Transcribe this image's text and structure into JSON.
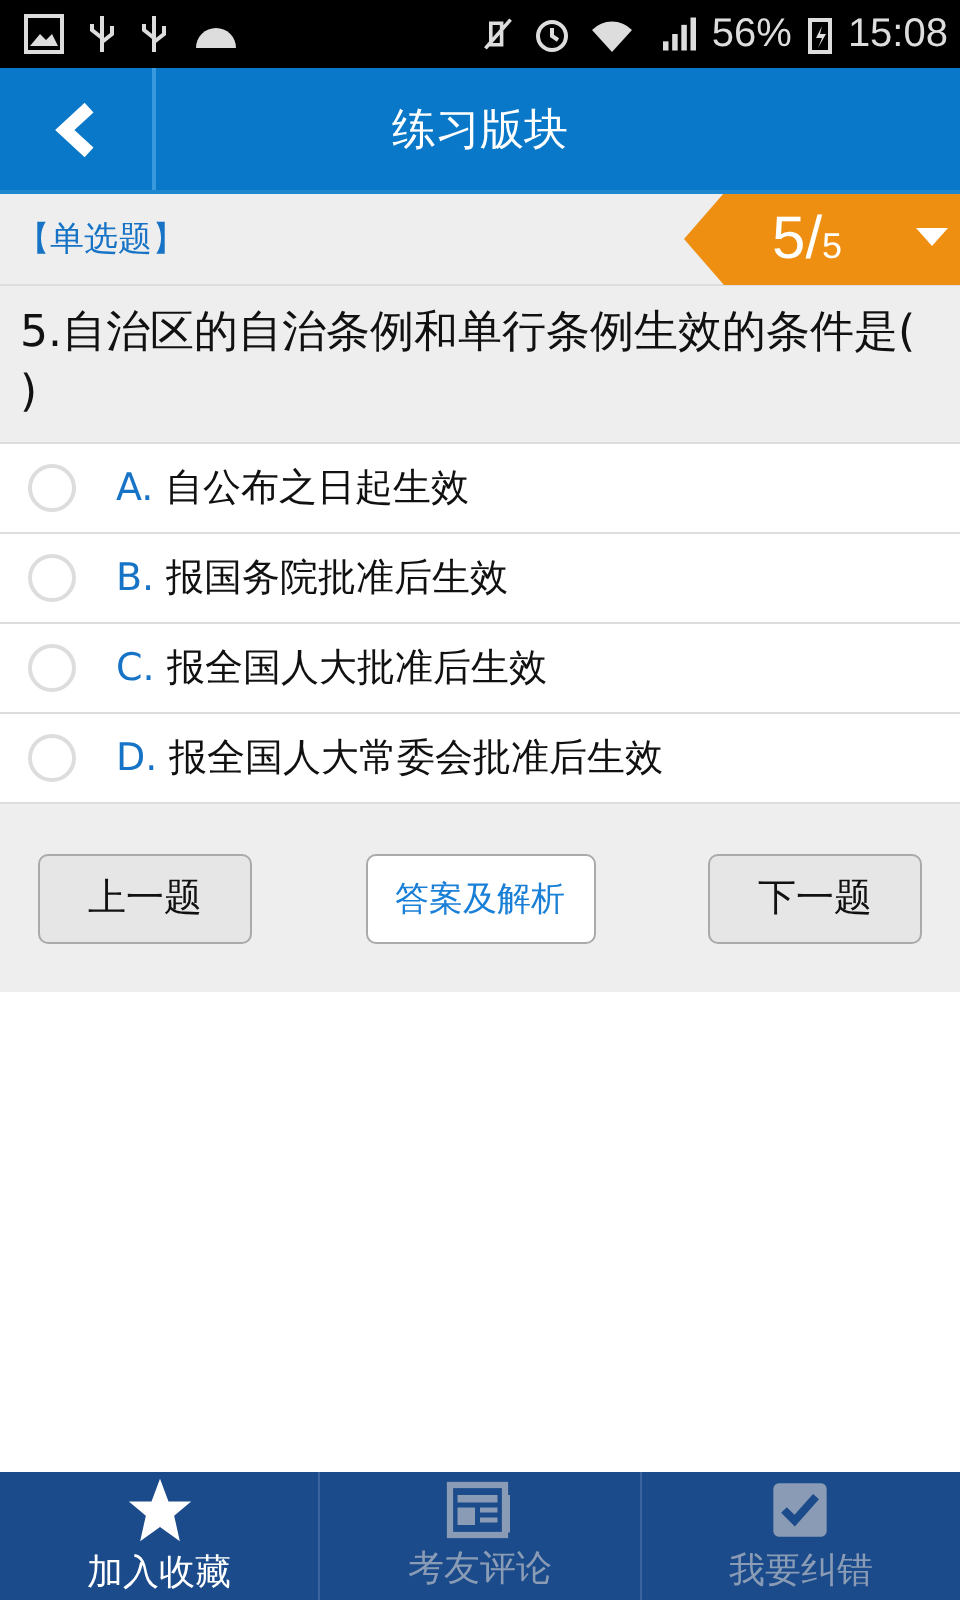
{
  "status_bar": {
    "battery": "56%",
    "time": "15:08"
  },
  "header": {
    "title": "练习版块"
  },
  "question": {
    "type_label": "【单选题】",
    "current": "5",
    "separator": "/",
    "total": "5",
    "text": "5.自治区的自治条例和单行条例生效的条件是( )"
  },
  "options": [
    {
      "letter": "A.",
      "text": "自公布之日起生效",
      "selected": false
    },
    {
      "letter": "B.",
      "text": "报国务院批准后生效",
      "selected": false
    },
    {
      "letter": "C.",
      "text": "报全国人大批准后生效",
      "selected": false
    },
    {
      "letter": "D.",
      "text": "报全国人大常委会批准后生效",
      "selected": false
    }
  ],
  "buttons": [
    {
      "kind": "plain",
      "label": "上一题"
    },
    {
      "kind": "accent",
      "label": "答案及解析"
    },
    {
      "kind": "plain",
      "label": "下一题"
    }
  ],
  "bottom_tabs": [
    {
      "kind": "star",
      "label": "加入收藏",
      "selected": true
    },
    {
      "kind": "news",
      "label": "考友评论",
      "selected": false
    },
    {
      "kind": "check",
      "label": "我要纠错",
      "selected": false
    }
  ]
}
